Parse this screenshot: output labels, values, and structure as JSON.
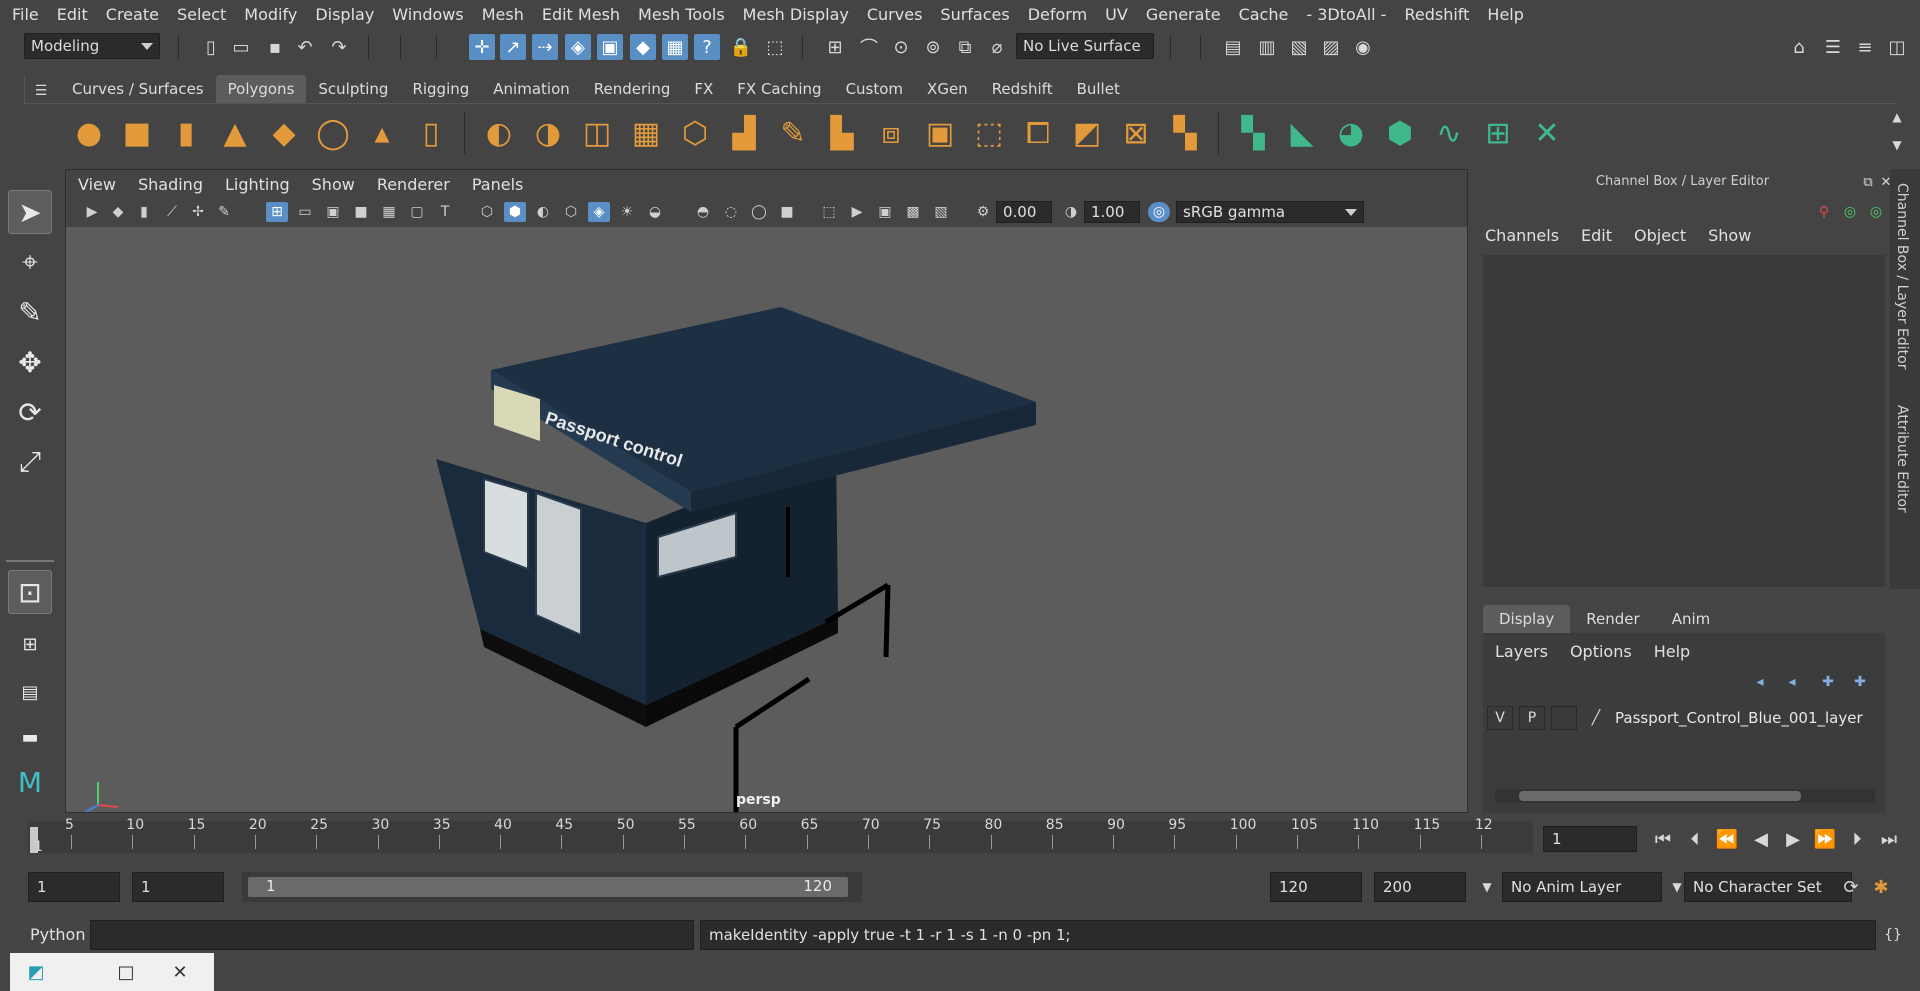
{
  "menubar": [
    "File",
    "Edit",
    "Create",
    "Select",
    "Modify",
    "Display",
    "Windows",
    "Mesh",
    "Edit Mesh",
    "Mesh Tools",
    "Mesh Display",
    "Curves",
    "Surfaces",
    "Deform",
    "UV",
    "Generate",
    "Cache",
    "- 3DtoAll -",
    "Redshift",
    "Help"
  ],
  "status": {
    "mode": "Modeling",
    "live_surface": "No Live Surface"
  },
  "shelf_tabs": [
    "Curves / Surfaces",
    "Polygons",
    "Sculpting",
    "Rigging",
    "Animation",
    "Rendering",
    "FX",
    "FX Caching",
    "Custom",
    "XGen",
    "Redshift",
    "Bullet"
  ],
  "shelf_active": "Polygons",
  "viewport": {
    "menu": [
      "View",
      "Shading",
      "Lighting",
      "Show",
      "Renderer",
      "Panels"
    ],
    "exposure": "0.00",
    "gamma": "1.00",
    "color_space": "sRGB gamma",
    "camera": "persp",
    "model_sign": "Passport control",
    "colors": {
      "booth": "#1a2b3d",
      "roof": "#1d2f42",
      "panel": "#c9cfd3",
      "background": "#5c5c5c"
    }
  },
  "right_panel": {
    "title": "Channel Box / Layer Editor",
    "menu": [
      "Channels",
      "Edit",
      "Object",
      "Show"
    ],
    "tabs": [
      "Display",
      "Render",
      "Anim"
    ],
    "active_tab": "Display",
    "layer_menu": [
      "Layers",
      "Options",
      "Help"
    ],
    "layer": {
      "v": "V",
      "p": "P",
      "name": "Passport_Control_Blue_001_layer"
    },
    "side_tabs": [
      "Channel Box / Layer Editor",
      "Attribute Editor"
    ]
  },
  "timeline": {
    "ticks": [
      "5",
      "10",
      "15",
      "20",
      "25",
      "30",
      "35",
      "40",
      "45",
      "50",
      "55",
      "60",
      "65",
      "70",
      "75",
      "80",
      "85",
      "90",
      "95",
      "100",
      "105",
      "110",
      "115",
      "12"
    ],
    "first_label": "1",
    "current_frame": "1"
  },
  "range": {
    "start": "1",
    "playback_start": "1",
    "range_start": "1",
    "range_end": "120",
    "playback_end": "120",
    "end": "200",
    "anim_layer": "No Anim Layer",
    "char_set": "No Character Set"
  },
  "cmdline": {
    "lang": "Python",
    "output": "makeIdentity -apply true -t 1 -r 1 -s 1 -n 0 -pn 1;"
  }
}
